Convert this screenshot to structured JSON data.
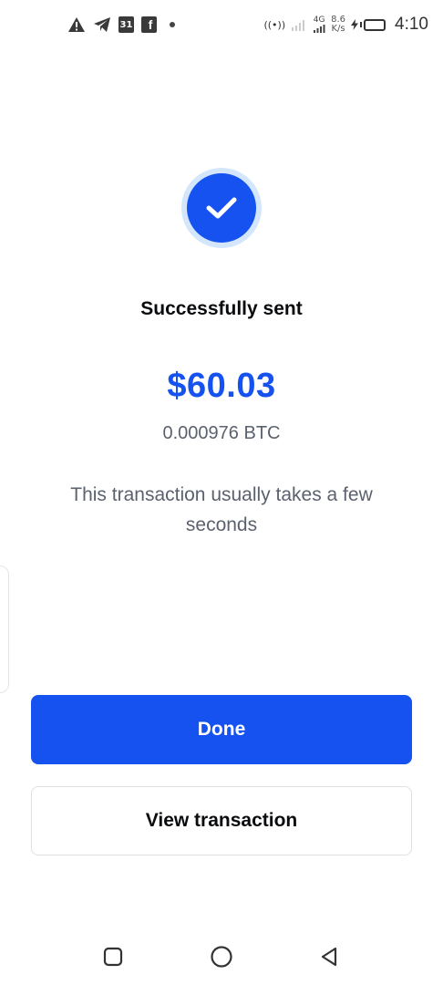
{
  "status_bar": {
    "calendar_day": "31",
    "facebook_glyph": "f",
    "hotspot": "((•))",
    "network_type": "4G",
    "speed_value": "8.6",
    "speed_unit": "K/s",
    "time": "4:10",
    "icons": [
      "warning-icon",
      "telegram-icon",
      "calendar-icon",
      "facebook-icon",
      "notification-dot-icon",
      "hotspot-icon",
      "signal-icon",
      "battery-icon"
    ]
  },
  "success": {
    "icon": "check-icon",
    "accent_color": "#1652f0",
    "title": "Successfully sent",
    "amount": "$60.03",
    "crypto_amount": "0.000976 BTC",
    "note": "This transaction usually takes a few seconds"
  },
  "actions": {
    "done_label": "Done",
    "view_transaction_label": "View transaction"
  },
  "nav": {
    "icons": [
      "recent-apps-icon",
      "home-icon",
      "back-icon"
    ]
  }
}
